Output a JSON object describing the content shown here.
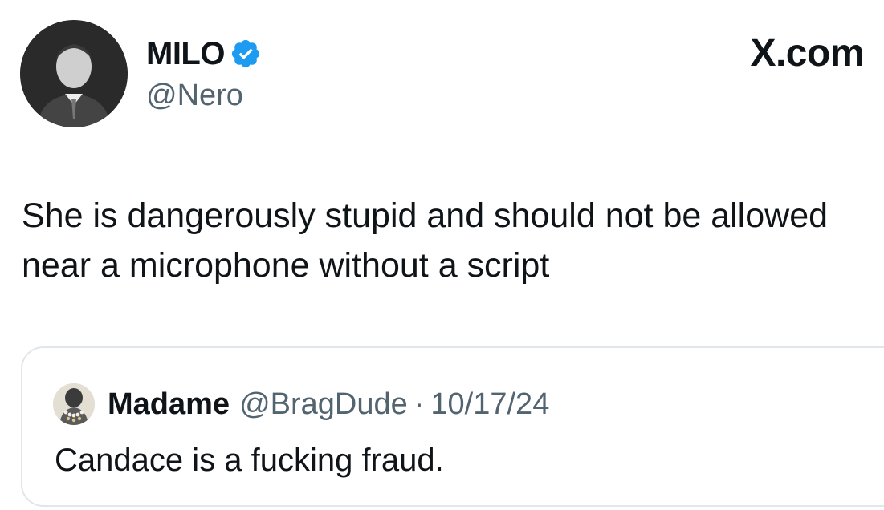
{
  "post": {
    "author": {
      "display_name": "MILO",
      "handle": "@Nero",
      "verified": true,
      "verified_color": "#1d9bf0"
    },
    "platform_label": "X.com",
    "text": "She is dangerously stupid and should not be allowed near a microphone without a script",
    "quoted": {
      "author_name": "Madame",
      "handle": "@BragDude",
      "separator": "·",
      "date": "10/17/24",
      "text": "Candace is a fucking fraud."
    }
  },
  "colors": {
    "text_primary": "#0f1419",
    "text_secondary": "#536471",
    "border": "#e1e6ea"
  },
  "icons": {
    "verified": "verified-badge-icon"
  }
}
